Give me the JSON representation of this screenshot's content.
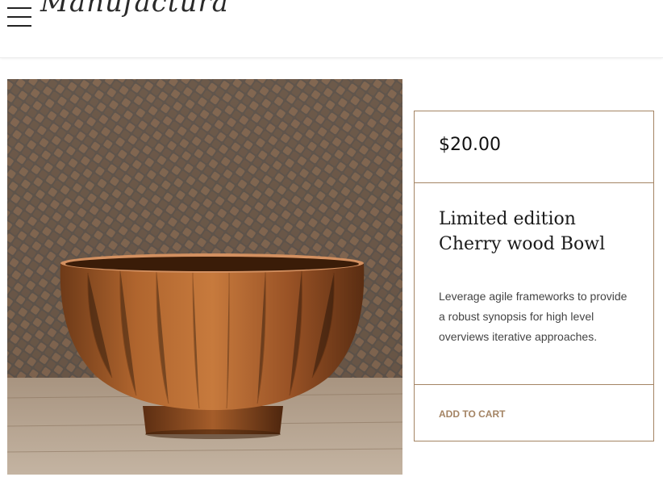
{
  "header": {
    "logo_text": "Manufactura",
    "menu_icon": "hamburger-menu-icon"
  },
  "product": {
    "image_alt": "Cherry wood bowl on wooden table",
    "price": "$20.00",
    "title": "Limited edition Cherry wood Bowl",
    "description": "Leverage agile frameworks to provide a robust synopsis for high level overviews iterative approaches.",
    "add_to_cart_label": "ADD TO CART"
  },
  "colors": {
    "accent": "#a48464",
    "text_dark": "#1a1a1a",
    "border": "#a48464"
  }
}
